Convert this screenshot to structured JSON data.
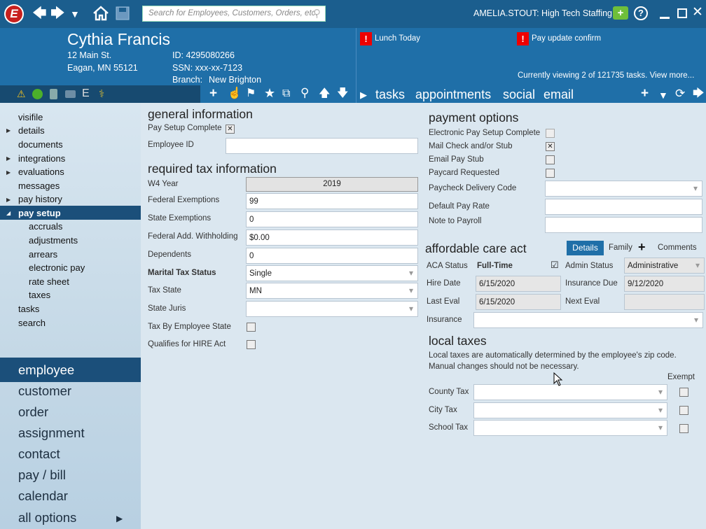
{
  "toolbar": {
    "search_placeholder": "Search for Employees, Customers, Orders, etc.",
    "user": "AMELIA.STOUT: High Tech Staffing",
    "logo": "E"
  },
  "header": {
    "name": "Cythia Francis",
    "address1": "12 Main St.",
    "address2": "Eagan, MN 55121",
    "id": "ID: 4295080266",
    "ssn": "SSN: xxx-xx-7123",
    "branch_label": "Branch:",
    "branch": "New Brighton",
    "alerts": [
      "Lunch Today",
      "Pay update confirm"
    ],
    "viewing": "Currently viewing 2 of 121735 tasks. View more...",
    "tabs": [
      "tasks",
      "appointments",
      "social",
      "email"
    ],
    "alert_mark": "!",
    "e_icon": "E"
  },
  "sidebar": {
    "items": [
      "visifile",
      "details",
      "documents",
      "integrations",
      "evaluations",
      "messages",
      "pay history",
      "pay setup"
    ],
    "subitems": [
      "accruals",
      "adjustments",
      "arrears",
      "electronic pay",
      "rate sheet",
      "taxes"
    ],
    "items2": [
      "tasks",
      "search"
    ],
    "big": [
      "employee",
      "customer",
      "order",
      "assignment",
      "contact",
      "pay / bill",
      "calendar",
      "all options"
    ]
  },
  "general": {
    "title": "general information",
    "pay_setup_complete": "Pay Setup Complete",
    "employee_id": "Employee ID",
    "employee_id_value": ""
  },
  "tax": {
    "title": "required tax information",
    "w4_year": "W4 Year",
    "w4_year_value": "2019",
    "federal_exemptions": "Federal Exemptions",
    "federal_exemptions_value": "99",
    "state_exemptions": "State Exemptions",
    "state_exemptions_value": "0",
    "federal_add": "Federal Add. Withholding",
    "federal_add_value": "$0.00",
    "dependents": "Dependents",
    "dependents_value": "0",
    "marital": "Marital Tax Status",
    "marital_value": "Single",
    "tax_state": "Tax State",
    "tax_state_value": "MN",
    "state_juris": "State Juris",
    "state_juris_value": "",
    "tax_by_state": "Tax By Employee State",
    "hire_act": "Qualifies for HIRE Act"
  },
  "payment": {
    "title": "payment options",
    "electronic": "Electronic Pay Setup Complete",
    "mail_check": "Mail Check and/or Stub",
    "email_stub": "Email Pay Stub",
    "paycard": "Paycard Requested",
    "delivery_code": "Paycheck Delivery Code",
    "default_rate": "Default Pay Rate",
    "note": "Note to Payroll"
  },
  "aca": {
    "title": "affordable care act",
    "tab_details": "Details",
    "tab_family": "Family",
    "tab_comments": "Comments",
    "aca_status": "ACA Status",
    "aca_status_value": "Full-Time",
    "admin_status": "Admin Status",
    "admin_status_value": "Administrative",
    "hire_date": "Hire Date",
    "hire_date_value": "6/15/2020",
    "insurance_due": "Insurance Due",
    "insurance_due_value": "9/12/2020",
    "last_eval": "Last Eval",
    "last_eval_value": "6/15/2020",
    "next_eval": "Next Eval",
    "next_eval_value": "",
    "insurance": "Insurance"
  },
  "local": {
    "title": "local taxes",
    "note1": "Local taxes are automatically determined by the employee's zip code.",
    "note2": "Manual changes should not be necessary.",
    "exempt": "Exempt",
    "county": "County Tax",
    "city": "City Tax",
    "school": "School Tax"
  }
}
